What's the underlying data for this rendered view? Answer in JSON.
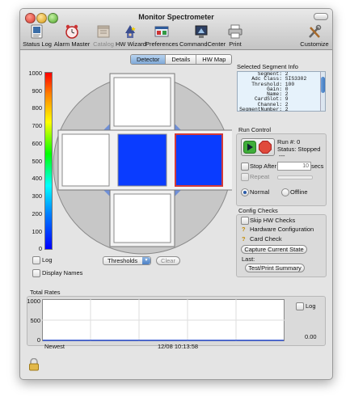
{
  "window": {
    "title": "Monitor Spectrometer"
  },
  "toolbar": [
    {
      "label": "Status Log",
      "icon": "status-log-icon",
      "enabled": true
    },
    {
      "label": "Alarm Master",
      "icon": "alarm-clock-icon",
      "enabled": true
    },
    {
      "label": "Catalog",
      "icon": "catalog-icon",
      "enabled": false
    },
    {
      "label": "HW Wizard",
      "icon": "wizard-icon",
      "enabled": true
    },
    {
      "label": "Preferences",
      "icon": "preferences-icon",
      "enabled": true
    },
    {
      "label": "CommandCenter",
      "icon": "command-center-icon",
      "enabled": true
    },
    {
      "label": "Print",
      "icon": "printer-icon",
      "enabled": true
    },
    {
      "label": "Customize",
      "icon": "tools-icon",
      "enabled": true
    }
  ],
  "tabs": [
    {
      "label": "Detector",
      "selected": true
    },
    {
      "label": "Details",
      "selected": false
    },
    {
      "label": "HW Map",
      "selected": false
    }
  ],
  "colorbar": {
    "ticks": [
      "1000",
      "900",
      "800",
      "700",
      "600",
      "500",
      "400",
      "300",
      "200",
      "100",
      "0"
    ]
  },
  "detector": {
    "segments": [
      {
        "name": "top",
        "color": "#ffffff"
      },
      {
        "name": "left",
        "color": "#ffffff"
      },
      {
        "name": "center",
        "color": "#0a3cff"
      },
      {
        "name": "right",
        "color": "#0a3cff",
        "selected": true
      },
      {
        "name": "bottom",
        "color": "#ffffff"
      }
    ]
  },
  "options": {
    "log_label": "Log",
    "display_names_label": "Display Names",
    "display_select": "Thresholds",
    "clear_label": "Clear"
  },
  "segment_info": {
    "title": "Selected Segment Info",
    "rows": [
      {
        "key": "Segment:",
        "value": "2"
      },
      {
        "key": "Adc Class:",
        "value": "SIS3302"
      },
      {
        "key": "Threshold:",
        "value": "100"
      },
      {
        "key": "Gain:",
        "value": "0"
      },
      {
        "key": "Name:",
        "value": "2"
      },
      {
        "key": "CardSlot:",
        "value": "9"
      },
      {
        "key": "Channel:",
        "value": "2"
      },
      {
        "key": "SegmentNumber:",
        "value": "2"
      }
    ]
  },
  "run_control": {
    "title": "Run Control",
    "run_number": "Run #: 0",
    "status": "Status: Stopped",
    "sub_status": "---",
    "stop_after_label": "Stop After",
    "stop_after_value": "10",
    "stop_after_unit": "secs",
    "repeat_label": "Repeat",
    "normal_label": "Normal",
    "offline_label": "Offline",
    "mode": "Normal"
  },
  "config_checks": {
    "title": "Config Checks",
    "skip_label": "Skip HW Checks",
    "hardware_label": "Hardware Configuration",
    "card_label": "Card Check",
    "capture_label": "Capture Current State",
    "last_label": "Last:",
    "summary_label": "Test/Print Summary"
  },
  "rates": {
    "title": "Total Rates",
    "yticks": [
      "1000",
      "500",
      "0"
    ],
    "x_left": "Newest",
    "x_time": "12/08 10:13:58",
    "log_label": "Log",
    "value": "0.00"
  },
  "status_bar": {
    "icon": "lock-icon"
  }
}
